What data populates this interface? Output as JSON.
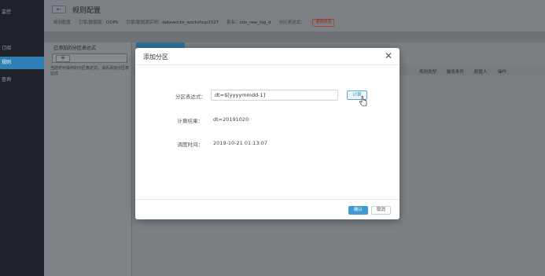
{
  "nav": {
    "top_label": "监控",
    "items": [
      {
        "label": "订阅",
        "active": false
      },
      {
        "label": "规则",
        "active": true
      },
      {
        "label": "查询",
        "active": false
      }
    ]
  },
  "header": {
    "back_label": "←",
    "title": "规则配置",
    "meta": {
      "breadcrumb": "规则配置",
      "engine_label": "引擎/数据源：",
      "engine_value": "ODPS",
      "instance_label": "引擎/数据源实例：",
      "instance_value": "dataworks_workshop2027",
      "table_label": "表名：",
      "table_value": "ods_raw_log_d",
      "partition_label": "分区表达式：",
      "warn_btn": "更新规则"
    }
  },
  "left_panel": {
    "title": "已添加的分区表达式",
    "add_symbol": "+",
    "hint": "当前无可操作的分区表达式，请先添加分区表达式"
  },
  "table": {
    "columns": [
      "类型",
      "规则类型",
      "触发条件",
      "配置人",
      "操作"
    ]
  },
  "modal": {
    "title": "添加分区",
    "close_symbol": "✕",
    "expr_label": "分区表达式：",
    "expr_value": "dt=$[yyyymmdd-1]",
    "calc_button": "计算",
    "result_label": "计算结果：",
    "result_value": "dt=20191020",
    "schedule_label": "调度时间：",
    "schedule_value": "2019-10-21 01:13:07",
    "ok_button": "确认",
    "cancel_button": "取消"
  },
  "colors": {
    "accent": "#3d9bd1",
    "nav_active": "#2f7fb5"
  }
}
